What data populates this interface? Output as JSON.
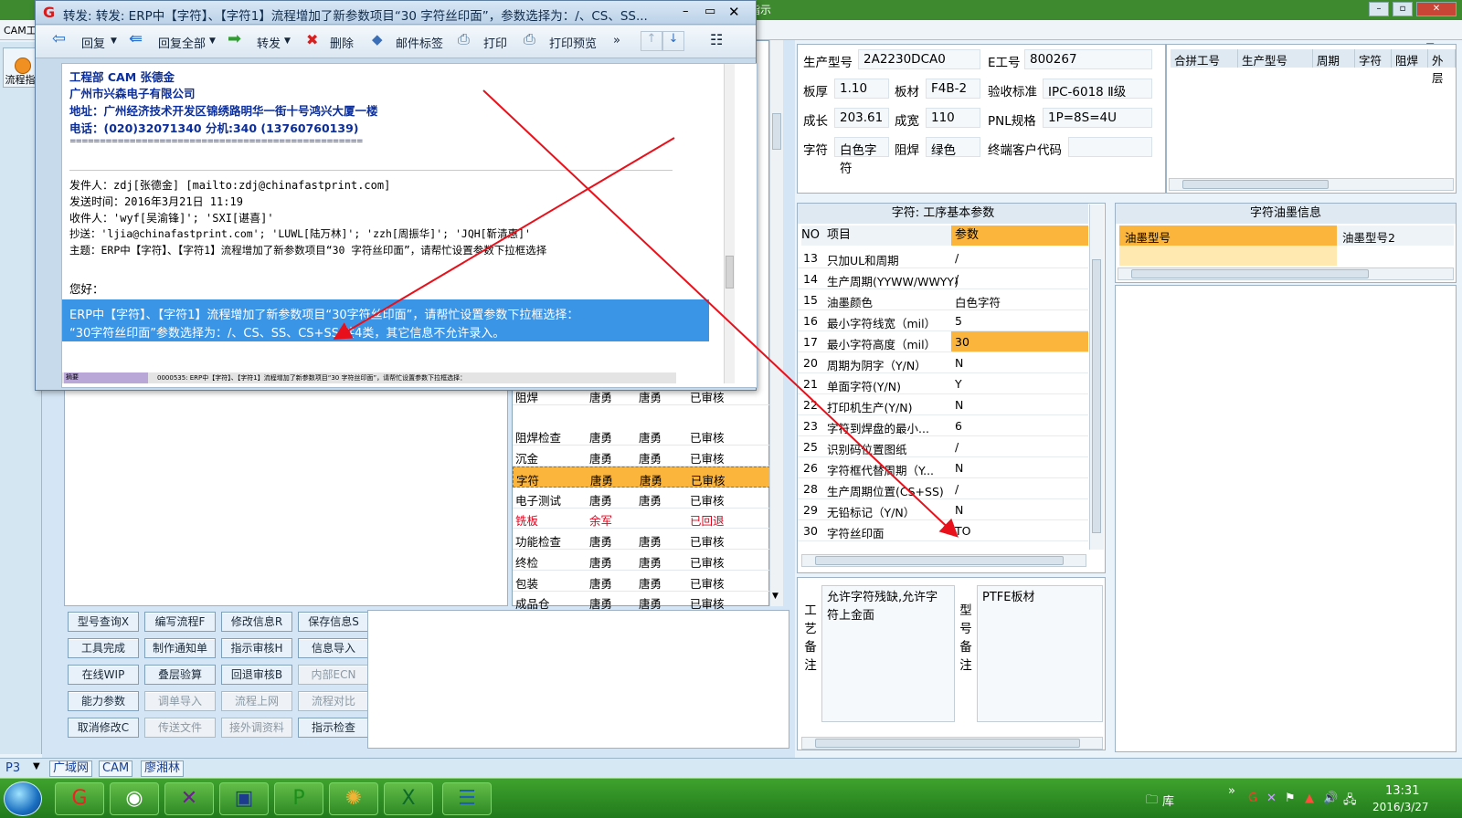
{
  "window": {
    "cam_label": "CAM工",
    "help_tab": "程指示"
  },
  "left_nav": {
    "flow_label": "流程指"
  },
  "popup": {
    "title": "转发: 转发: ERP中【字符】、【字符1】流程增加了新参数项目“30 字符丝印面”，参数选择为：/、CS、SS...",
    "toolbar": {
      "reply": "回复",
      "reply_all": "回复全部",
      "forward": "转发",
      "delete": "删除",
      "mail_tag": "邮件标签",
      "print": "打印",
      "print_preview": "打印预览",
      "more": "»"
    },
    "signature": {
      "dept": "工程部 CAM  张德金",
      "company": "广州市兴森电子有限公司",
      "address": "地址：广州经济技术开发区锦绣路明华一街十号鸿兴大厦一楼",
      "phone": "电话：(020)32071340 分机:340 (13760760139)",
      "rule": "================================================="
    },
    "header": {
      "from": "发件人：zdj[张德金] [mailto:zdj@chinafastprint.com]",
      "sent": "发送时间：2016年3月21日 11:19",
      "to": "收件人：'wyf[吴渝锋]'; 'SXI[谌喜]'",
      "cc": "抄送：'ljia@chinafastprint.com'; 'LUWL[陆万林]'; 'zzh[周振华]'; 'JQH[靳清惠]'",
      "subject": "主题：ERP中【字符】、【字符1】流程增加了新参数项目“30 字符丝印面”，请帮忙设置参数下拉框选择"
    },
    "greeting": "您好：",
    "body_line1": "ERP中【字符】、【字符1】流程增加了新参数项目“30字符丝印面”，请帮忙设置参数下拉框选择：",
    "body_line2": "“30字符丝印面”参数选择为：/、CS、SS、CS+SS 共4类，其它信息不允许录入。",
    "footer_preview": "0000535: ERP中【字符】、【字符1】流程增加了新参数项目“30 字符丝印面”，请帮忙设置参数下拉框选择：",
    "footer_tag": "摘要"
  },
  "process_rows": [
    {
      "step": "阻焊",
      "a": "唐勇",
      "b": "唐勇",
      "status": "已审核"
    },
    {
      "step": "阻焊检查",
      "a": "唐勇",
      "b": "唐勇",
      "status": "已审核"
    },
    {
      "step": "沉金",
      "a": "唐勇",
      "b": "唐勇",
      "status": "已审核"
    },
    {
      "step": "字符",
      "a": "唐勇",
      "b": "唐勇",
      "status": "已审核"
    },
    {
      "step": "电子测试",
      "a": "唐勇",
      "b": "唐勇",
      "status": "已审核"
    },
    {
      "step": "铣板",
      "a": "余军",
      "b": "",
      "status": "已回退"
    },
    {
      "step": "功能检查",
      "a": "唐勇",
      "b": "唐勇",
      "status": "已审核"
    },
    {
      "step": "终检",
      "a": "唐勇",
      "b": "唐勇",
      "status": "已审核"
    },
    {
      "step": "包装",
      "a": "唐勇",
      "b": "唐勇",
      "status": "已审核"
    },
    {
      "step": "成品仓",
      "a": "唐勇",
      "b": "唐勇",
      "status": "已审核"
    }
  ],
  "buttons": [
    [
      "型号查询X",
      "编写流程F",
      "修改信息R",
      "保存信息S"
    ],
    [
      "工具完成",
      "制作通知单",
      "指示审核H",
      "信息导入"
    ],
    [
      "在线WIP",
      "叠层验算",
      "回退审核B",
      "内部ECN"
    ],
    [
      "能力参数",
      "调单导入",
      "流程上网",
      "流程对比"
    ],
    [
      "取消修改C",
      "传送文件",
      "接外调资料",
      "指示检查"
    ]
  ],
  "info": {
    "model_label": "生产型号",
    "model": "2A2230DCA0",
    "e_label": "E工号",
    "e_no": "800267",
    "thick_label": "板厚",
    "thick": "1.10",
    "mat_label": "板材",
    "mat": "F4B-2",
    "std_label": "验收标准",
    "std": "IPC-6018 Ⅱ级",
    "len_label": "成长",
    "len": "203.61",
    "wid_label": "成宽",
    "wid": "110",
    "pnl_label": "PNL规格",
    "pnl": "1P=8S=4U",
    "char_label": "字符",
    "char": "白色字符",
    "mask_label": "阻焊",
    "mask": "绿色",
    "cust_label": "终端客户代码",
    "cust": ""
  },
  "combine_headers": [
    "合拼工号",
    "生产型号",
    "周期",
    "字符",
    "阻焊",
    "外层"
  ],
  "params": {
    "title": "字符: 工序基本参数",
    "col_no": "NO",
    "col_item": "项目",
    "col_val": "参数",
    "rows": [
      {
        "no": "13",
        "item": "只加UL和周期",
        "val": "/"
      },
      {
        "no": "14",
        "item": "生产周期(YYWW/WWYY)",
        "val": "/"
      },
      {
        "no": "15",
        "item": "油墨颜色",
        "val": "白色字符"
      },
      {
        "no": "16",
        "item": "最小字符线宽（mil）",
        "val": "5"
      },
      {
        "no": "17",
        "item": "最小字符高度（mil）",
        "val": "30"
      },
      {
        "no": "20",
        "item": "周期为阴字（Y/N）",
        "val": "N"
      },
      {
        "no": "21",
        "item": "单面字符(Y/N)",
        "val": "Y"
      },
      {
        "no": "22",
        "item": "打印机生产(Y/N)",
        "val": "N"
      },
      {
        "no": "23",
        "item": "字符到焊盘的最小...",
        "val": "6"
      },
      {
        "no": "25",
        "item": "识别码位置图纸",
        "val": "/"
      },
      {
        "no": "26",
        "item": "字符框代替周期（Y...",
        "val": "N"
      },
      {
        "no": "28",
        "item": "生产周期位置(CS+SS)",
        "val": "/"
      },
      {
        "no": "29",
        "item": "无铅标记（Y/N）",
        "val": "N"
      },
      {
        "no": "30",
        "item": "字符丝印面",
        "val": "TO"
      }
    ]
  },
  "ink": {
    "title": "字符油墨信息",
    "col1": "油墨型号",
    "col2": "油墨型号2"
  },
  "notes": {
    "process_label": "工艺备注",
    "process_text": "允许字符残缺,允许字符上金面",
    "model_label": "型号备注",
    "model_text": "PTFE板材"
  },
  "status": {
    "p3": "P3",
    "t1": "广域网",
    "t2": "CAM",
    "t3": "廖湘林"
  },
  "taskbar": {
    "tray_lib": "库",
    "time": "13:31",
    "date": "2016/3/27"
  },
  "colors": {
    "highlight": "#fbb53d",
    "selection": "#3b95e6",
    "arrow": "#e8101a",
    "taskbar": "#2f8a25"
  }
}
